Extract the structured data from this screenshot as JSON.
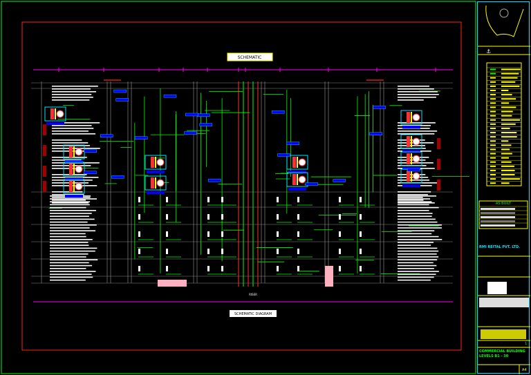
{
  "drawing": {
    "title_tag": "SCHEMATIC",
    "bottom_tag": "SCHEMATIC DIAGRAM",
    "riser_label": "RISER"
  },
  "title_block": {
    "status": "AS BUILT",
    "client": "RMI REITAL PVT. LTD.",
    "project_line1": "COMMERCIAL BUILDING",
    "project_line2": "LEVELS B1 - 30",
    "sheet_size": "A4",
    "sheet_no": "1"
  },
  "colors": {
    "frame": "#00ff00",
    "border": "#ff2020",
    "level_line": "#ff00ff",
    "pipe": "#00ff00",
    "tag": "#0000ff",
    "titleblock": "#00e5ff",
    "legend": "#ffff00"
  }
}
